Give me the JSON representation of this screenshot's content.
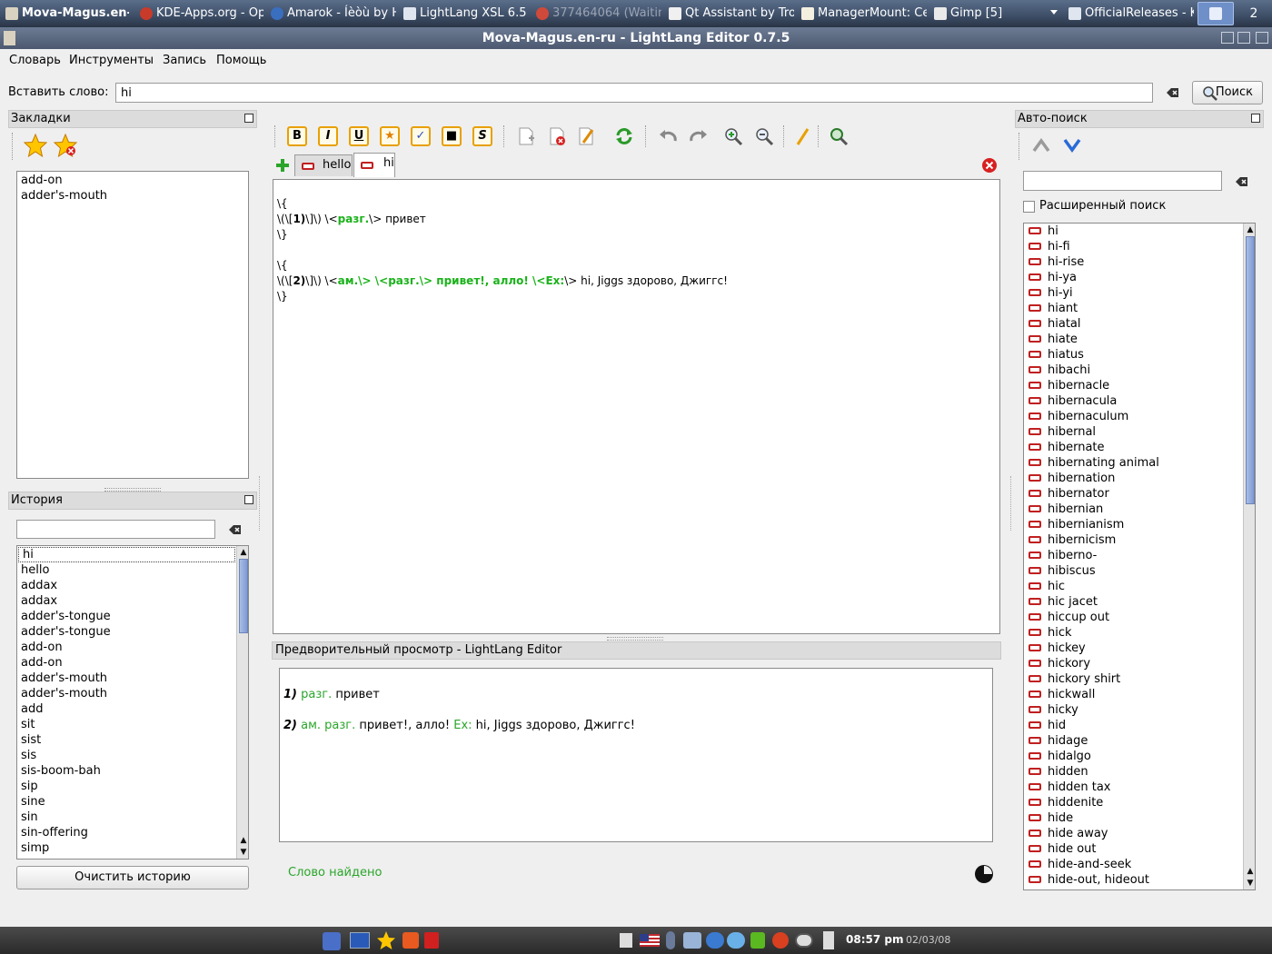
{
  "taskbar": {
    "tasks": [
      {
        "label": "Mova-Magus.en-"
      },
      {
        "label": "KDE-Apps.org - Ope"
      },
      {
        "label": "Amarok - Íèòù by H"
      },
      {
        "label": "LightLang XSL 6.5"
      },
      {
        "label": "377464064 (Waitin"
      },
      {
        "label": "Qt Assistant by Tro"
      },
      {
        "label": "ManagerMount: Ce"
      },
      {
        "label": "Gimp [5]"
      },
      {
        "label": "OfficialReleases - K"
      }
    ],
    "desktop2": "2"
  },
  "window": {
    "title": "Mova-Magus.en-ru - LightLang Editor 0.7.5"
  },
  "menu": [
    "Словарь",
    "Инструменты",
    "Запись",
    "Помощь"
  ],
  "insert": {
    "label": "Вставить слово:",
    "value": "hi",
    "search_button": "Поиск"
  },
  "bookmarks": {
    "title": "Закладки",
    "items": [
      "add-on",
      "adder's-mouth"
    ]
  },
  "history": {
    "title": "История",
    "filter_value": "",
    "items": [
      "hi",
      "hello",
      "addax",
      "addax",
      "adder's-tongue",
      "adder's-tongue",
      "add-on",
      "add-on",
      "adder's-mouth",
      "adder's-mouth",
      "add",
      "sit",
      "sist",
      "sis",
      "sis-boom-bah",
      "sip",
      "sine",
      "sin",
      "sin-offering",
      "simp"
    ],
    "clear_button": "Очистить историю"
  },
  "toolbar": {
    "format_buttons": [
      "B",
      "I",
      "U",
      "★",
      "✓",
      "■",
      "S"
    ]
  },
  "tabs": [
    {
      "label": "hello",
      "active": false
    },
    {
      "label": "hi",
      "active": true
    }
  ],
  "editor": {
    "lines": [
      {
        "plain": "\\{"
      },
      {
        "pre": "\\(\\[",
        "num": "1)",
        "post": "\\]\\) \\<",
        "tag": "разг.",
        "tail": "\\> привет"
      },
      {
        "plain": "\\}"
      },
      {
        "plain": ""
      },
      {
        "plain": "\\{"
      },
      {
        "pre": "\\(\\[",
        "num": "2)",
        "post": "\\]\\) \\<",
        "tag": "ам.\\> \\<разг.\\> привет!, алло! \\<Ex:",
        "tail": "\\> hi, Jiggs здорово, Джиггс!"
      },
      {
        "plain": "\\}"
      }
    ]
  },
  "preview": {
    "title": "Предворительный просмотр - LightLang Editor",
    "lines": [
      {
        "num": "1)",
        "label": "разг.",
        "text": "привет"
      },
      {
        "num": "2)",
        "label": "ам. разг.",
        "text": "привет!, алло!",
        "ex_label": "Ex:",
        "ex_text": "hi, Jiggs здорово, Джиггс!"
      }
    ]
  },
  "status": {
    "text": "Слово найдено"
  },
  "autosearch": {
    "title": "Авто-поиск",
    "filter_value": "",
    "extended_label": "Расширенный поиск",
    "extended_checked": false,
    "items": [
      "hi",
      "hi-fi",
      "hi-rise",
      "hi-ya",
      "hi-yi",
      "hiant",
      "hiatal",
      "hiate",
      "hiatus",
      "hibachi",
      "hibernacle",
      "hibernacula",
      "hibernaculum",
      "hibernal",
      "hibernate",
      "hibernating animal",
      "hibernation",
      "hibernator",
      "hibernian",
      "hibernianism",
      "hibernicism",
      "hiberno-",
      "hibiscus",
      "hic",
      "hic jacet",
      "hiccup out",
      "hick",
      "hickey",
      "hickory",
      "hickory shirt",
      "hickwall",
      "hicky",
      "hid",
      "hidage",
      "hidalgo",
      "hidden",
      "hidden tax",
      "hiddenite",
      "hide",
      "hide away",
      "hide out",
      "hide-and-seek",
      "hide-out, hideout"
    ]
  },
  "tray": {
    "time": "08:57 pm",
    "date": "02/03/08"
  },
  "colors": {
    "accent_green": "#1ab21a",
    "selection_blue": "#7e9ad2"
  }
}
